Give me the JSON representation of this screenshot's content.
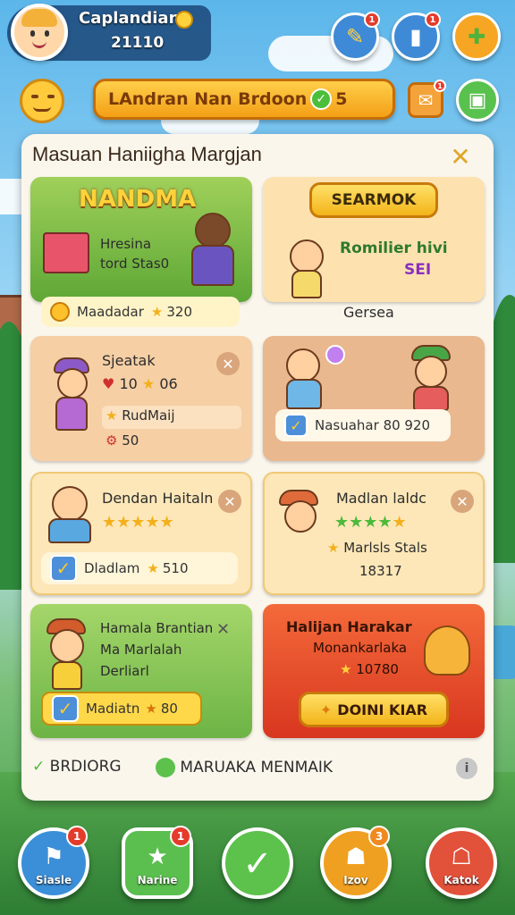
{
  "player": {
    "name": "Caplandian",
    "level": "21110"
  },
  "top_buttons": {
    "quest_badge": "1",
    "card_badge": "1"
  },
  "banner": {
    "text": "LAndran Nan Brdoon",
    "count": "5"
  },
  "mail_badge": "1",
  "panel": {
    "title": "Masuan Haniigha Margjan",
    "cards": [
      {
        "title": "NANDMA",
        "line1": "Hresina",
        "line2": "tord Stas0",
        "pill_label": "Maadadar",
        "pill_value": "320"
      },
      {
        "button": "SEARMOK",
        "banner": "Romilier hivi",
        "banner2": "SEI",
        "caption": "Gersea"
      },
      {
        "title": "Sjeatak",
        "rating": "10",
        "stars_value": "06",
        "sub": "RudMaij",
        "sub_value": "50"
      },
      {
        "pill_label": "Nasuahar",
        "pill_value": "80 920"
      },
      {
        "title": "Dendan Haitaln",
        "pill_label": "Dladlam",
        "pill_value": "510"
      },
      {
        "title": "Madlan laldc",
        "sub": "Marlsls Stals",
        "sub_value": "18317"
      },
      {
        "title1": "Hamala Brantian",
        "title2": "Ma Marlalah",
        "title3": "Derliarl",
        "pill_label": "Madiatn",
        "pill_value": "80"
      },
      {
        "title1": "Halijan Harakar",
        "title2": "Monankarlaka",
        "value": "10780",
        "button": "DOINI KIAR"
      }
    ],
    "footer": {
      "left": "BRDIORG",
      "right": "MARUAKA MENMAIK",
      "info": "i"
    }
  },
  "bottom_nav": [
    {
      "label": "Siasle",
      "badge": "1",
      "icon": "flag-icon",
      "color": "#3b8fd8"
    },
    {
      "label": "Narine",
      "badge": "1",
      "icon": "star-card-icon",
      "color": "#5bbf4f"
    },
    {
      "label": "",
      "badge": "",
      "icon": "check-icon",
      "color": "#5cc24c"
    },
    {
      "label": "Izov",
      "badge": "3",
      "icon": "tooth-icon",
      "color": "#f0a020"
    },
    {
      "label": "Katok",
      "badge": "",
      "icon": "ghost-icon",
      "color": "#e2513a"
    }
  ]
}
